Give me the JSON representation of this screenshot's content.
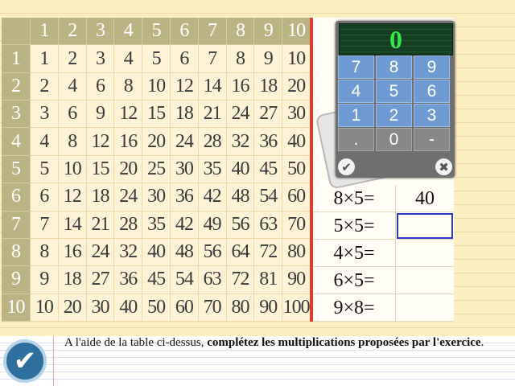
{
  "table": {
    "headers": [
      "1",
      "2",
      "3",
      "4",
      "5",
      "6",
      "7",
      "8",
      "9",
      "10"
    ],
    "rows": [
      [
        "1",
        "2",
        "3",
        "4",
        "5",
        "6",
        "7",
        "8",
        "9",
        "10"
      ],
      [
        "2",
        "4",
        "6",
        "8",
        "10",
        "12",
        "14",
        "16",
        "18",
        "20"
      ],
      [
        "3",
        "6",
        "9",
        "12",
        "15",
        "18",
        "21",
        "24",
        "27",
        "30"
      ],
      [
        "4",
        "8",
        "12",
        "16",
        "20",
        "24",
        "28",
        "32",
        "36",
        "40"
      ],
      [
        "5",
        "10",
        "15",
        "20",
        "25",
        "30",
        "35",
        "40",
        "45",
        "50"
      ],
      [
        "6",
        "12",
        "18",
        "24",
        "30",
        "36",
        "42",
        "48",
        "54",
        "60"
      ],
      [
        "7",
        "14",
        "21",
        "28",
        "35",
        "42",
        "49",
        "56",
        "63",
        "70"
      ],
      [
        "8",
        "16",
        "24",
        "32",
        "40",
        "48",
        "56",
        "64",
        "72",
        "80"
      ],
      [
        "9",
        "18",
        "27",
        "36",
        "45",
        "54",
        "63",
        "72",
        "81",
        "90"
      ],
      [
        "10",
        "20",
        "30",
        "40",
        "50",
        "60",
        "70",
        "80",
        "90",
        "100"
      ]
    ]
  },
  "questions": [
    {
      "expr": "8×5=",
      "answer": "40"
    },
    {
      "expr": "5×5=",
      "answer": ""
    },
    {
      "expr": "4×5=",
      "answer": ""
    },
    {
      "expr": "6×5=",
      "answer": ""
    },
    {
      "expr": "9×8=",
      "answer": ""
    }
  ],
  "keypad": {
    "display": "0",
    "keys": [
      "7",
      "8",
      "9",
      "4",
      "5",
      "6",
      "1",
      "2",
      "3",
      ".",
      "0",
      "-"
    ],
    "ok_icon": "check-circle-icon",
    "clear_icon": "close-circle-icon"
  },
  "instruction": {
    "prefix": "A l'aide de la table ci-dessus, ",
    "bold": "complétez les multiplications proposées par l'exercice",
    "suffix": "."
  },
  "colors": {
    "accent_red": "#e23a2a",
    "header_bg": "#bab383",
    "key_blue": "#6f9ad2",
    "display_green": "#35e64a",
    "active_border": "#2a3ac8"
  }
}
